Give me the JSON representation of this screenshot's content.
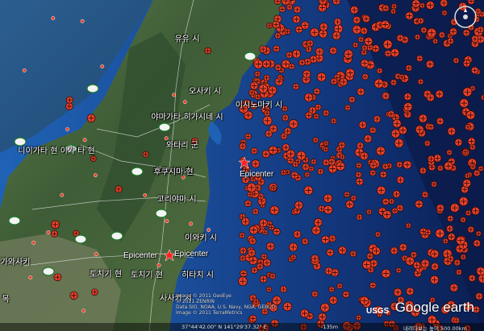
{
  "map": {
    "type": "satellite-map",
    "region": "Tohoku",
    "epicenter_label": "Epicenter",
    "places": [
      {
        "name": "유유 시",
        "icon": "town-icon"
      },
      {
        "name": "오사키 시",
        "icon": "town-icon"
      },
      {
        "name": "이시노마키 시",
        "icon": "town-icon"
      },
      {
        "name": "야마가타 히가시네 시",
        "icon": "town-icon"
      },
      {
        "name": "와타리 군",
        "icon": "town-icon"
      },
      {
        "name": "니이가타 현 이가 타 현",
        "icon": "prefecture-icon"
      },
      {
        "name": "후쿠시마 현",
        "icon": "prefecture-icon"
      },
      {
        "name": "후쿠시마 현",
        "icon": "prefecture-icon"
      },
      {
        "name": "고리야마 시",
        "icon": "town-icon"
      },
      {
        "name": "이와키 시",
        "icon": "town-icon"
      },
      {
        "name": "토치기 현",
        "icon": "prefecture-icon"
      },
      {
        "name": "토치기 현",
        "icon": "prefecture-icon"
      },
      {
        "name": "히타치 시",
        "icon": "town-icon"
      },
      {
        "name": "가와사키",
        "icon": "town-icon"
      },
      {
        "name": "사사키 시",
        "icon": "town-icon"
      },
      {
        "name": "목",
        "icon": "town-icon"
      }
    ],
    "credit_lines": [
      "Image © 2011 GeoEye",
      "© 2011 ZENRIN",
      "Data SIO, NOAA, U.S. Navy, NGA, GEBCO",
      "Image © 2011 TerraMetrics"
    ],
    "status": {
      "coordinates": "37°44'42.00\" N  141°29'37.32\" E",
      "elevation": "-135m",
      "eye_altitude": "내려다보는 높이 500.00km"
    },
    "logos": {
      "google": "Google earth",
      "usgs": "USGS"
    },
    "colors": {
      "quake_marker": "#e8432c",
      "ocean_deep": "#0d2a6e",
      "land": "#3d5e3a"
    }
  }
}
